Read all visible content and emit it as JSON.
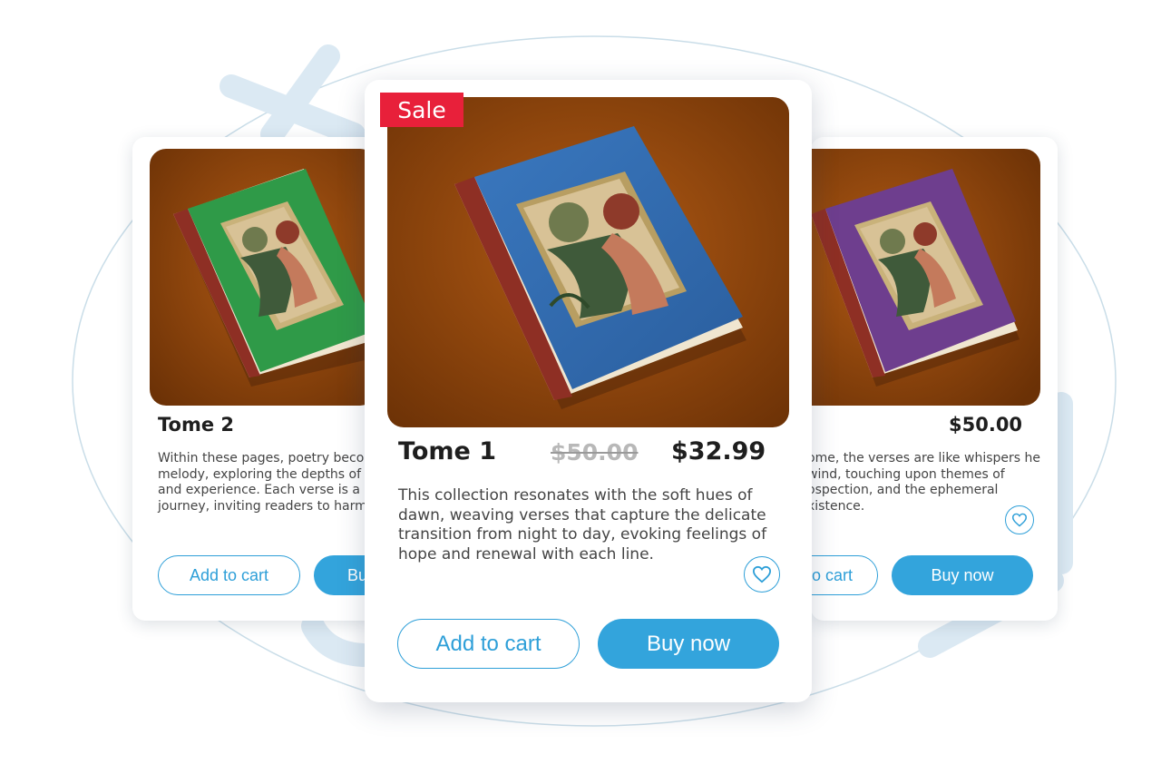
{
  "colors": {
    "accent": "#33a4dc",
    "sale": "#e8203a",
    "background_wood": "#8a4209",
    "cover_green": "#2f9a48",
    "cover_blue": "#2e66a8",
    "cover_purple": "#6e3e8e"
  },
  "products": {
    "left": {
      "title": "Tome 2",
      "description": "Within these pages, poetry beco melody, exploring the depths of and experience. Each verse is a l journey, inviting readers to harm",
      "add_to_cart": "Add to cart",
      "buy_now": "Bu"
    },
    "main": {
      "badge": "Sale",
      "title": "Tome 1",
      "old_price": "$50.00",
      "price": "$32.99",
      "description": "This collection resonates with the soft hues of dawn, weaving verses that capture the delicate transition from night to day, evoking feelings of hope and renewal with each line.",
      "add_to_cart": "Add to cart",
      "buy_now": "Buy now",
      "favorite_icon": "heart-icon"
    },
    "right": {
      "price": "$50.00",
      "description": "ome, the verses are like whispers he wind, touching upon themes of ospection, and the ephemeral xistence.",
      "add_to_cart": "o cart",
      "buy_now": "Buy now",
      "favorite_icon": "heart-icon"
    }
  }
}
